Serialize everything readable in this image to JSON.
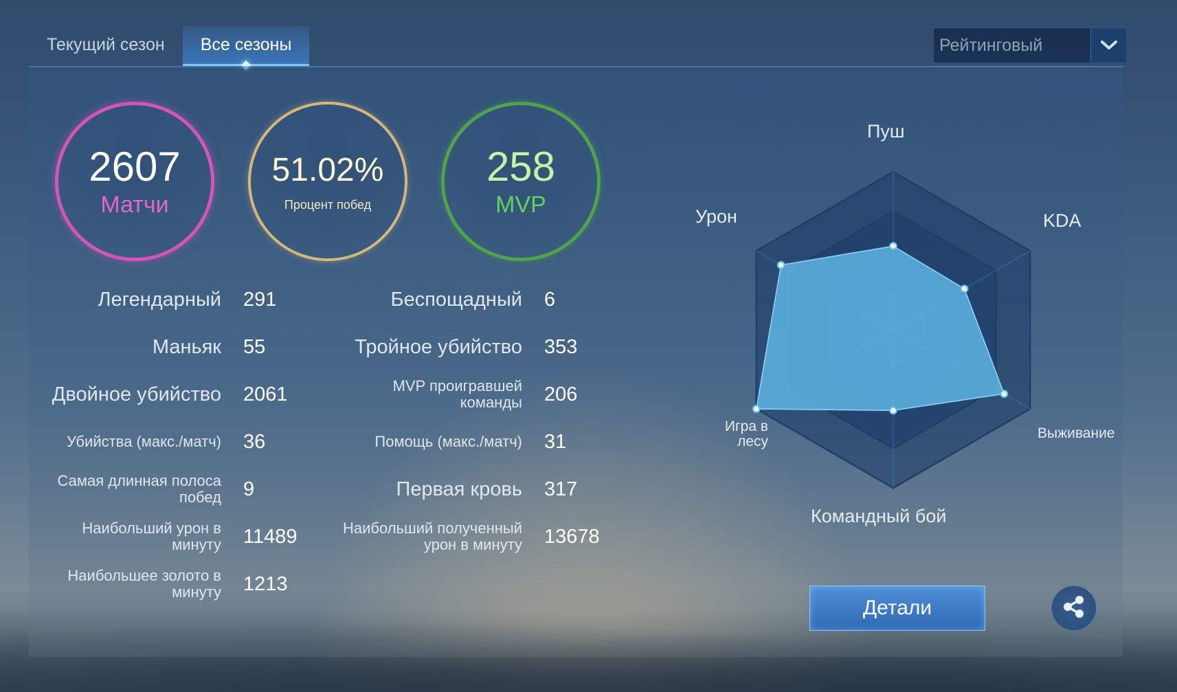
{
  "tabs": [
    {
      "label": "Текущий сезон",
      "active": false
    },
    {
      "label": "Все сезоны",
      "active": true
    }
  ],
  "mode_select": {
    "value": "Рейтинговый",
    "icon": "chevron-down-icon"
  },
  "summary": {
    "matches": {
      "value": "2607",
      "label": "Матчи"
    },
    "win_rate": {
      "value": "51.02%",
      "label": "Процент побед"
    },
    "mvp": {
      "value": "258",
      "label": "MVP"
    }
  },
  "stats_left": [
    {
      "label": "Легендарный",
      "value": "291"
    },
    {
      "label": "Маньяк",
      "value": "55"
    },
    {
      "label": "Двойное убийство",
      "value": "2061"
    },
    {
      "label": "Убийства (макс./матч)",
      "value": "36"
    },
    {
      "label": "Самая длинная полоса побед",
      "value": "9"
    },
    {
      "label": "Наибольший урон в минуту",
      "value": "11489"
    },
    {
      "label": "Наибольшее золото в минуту",
      "value": "1213"
    }
  ],
  "stats_right": [
    {
      "label": "Беспощадный",
      "value": "6"
    },
    {
      "label": "Тройное убийство",
      "value": "353"
    },
    {
      "label": "MVP проигравшей команды",
      "value": "206"
    },
    {
      "label": "Помощь (макс./матч)",
      "value": "31"
    },
    {
      "label": "Первая кровь",
      "value": "317"
    },
    {
      "label": "Наибольший полученный урон в минуту",
      "value": "13678"
    }
  ],
  "radar": {
    "axes": [
      {
        "label": "Пуш",
        "value": 0.53
      },
      {
        "label": "KDA",
        "value": 0.52
      },
      {
        "label": "Выживание",
        "value": 0.81
      },
      {
        "label": "Командный бой",
        "value": 0.51
      },
      {
        "label": "Игра в лесу",
        "value": 1.0
      },
      {
        "label": "Урон",
        "value": 0.82
      }
    ],
    "fill_color": "#5fb8e6",
    "grid_color": "#1f3f6b"
  },
  "actions": {
    "details_label": "Детали",
    "share_icon": "share-icon"
  },
  "colors": {
    "matches_ring": "#d256b7",
    "winrate_ring": "#d4b77b",
    "mvp_ring": "#4fa34c",
    "accent": "#4f8fd6"
  }
}
